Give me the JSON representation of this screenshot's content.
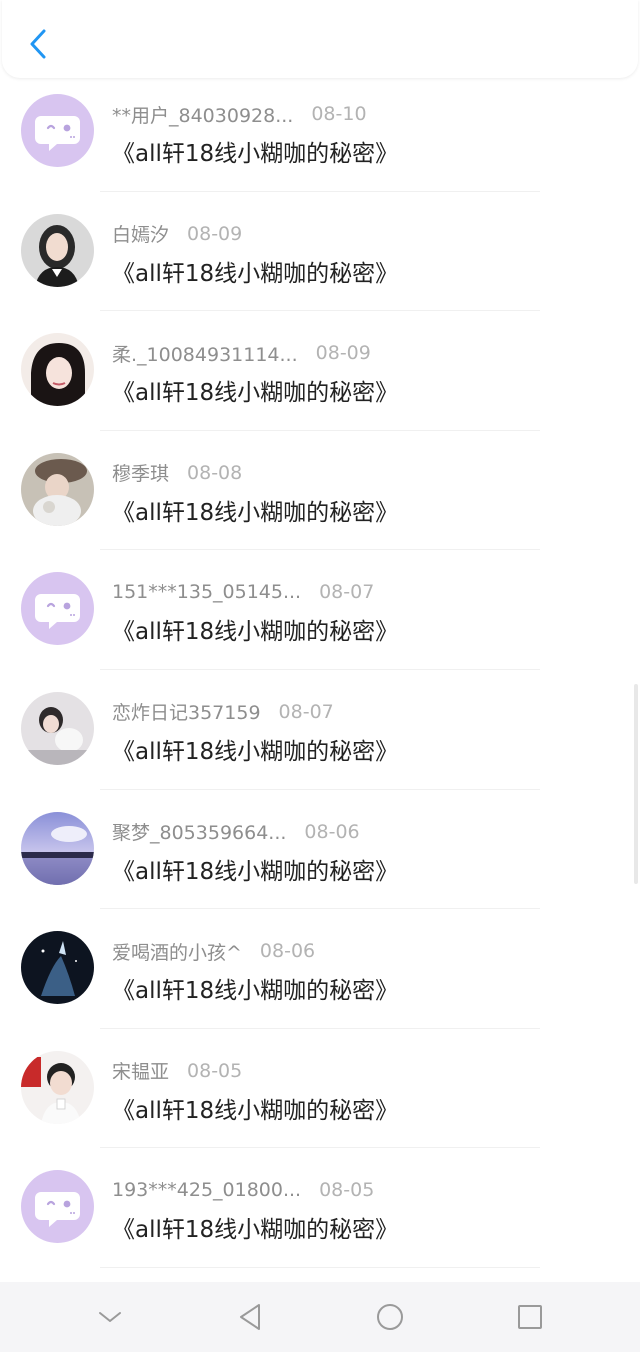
{
  "header": {
    "back_label": "<"
  },
  "comments": [
    {
      "name": "**用户_84030928...",
      "date": "08-10",
      "text": "《all轩18线小糊咖的秘密》",
      "avatar": "default-avatar-icon"
    },
    {
      "name": "白嫣汐",
      "date": "08-09",
      "text": "《all轩18线小糊咖的秘密》",
      "avatar": "user-photo"
    },
    {
      "name": "柔._10084931114...",
      "date": "08-09",
      "text": "《all轩18线小糊咖的秘密》",
      "avatar": "user-photo"
    },
    {
      "name": "穆季琪",
      "date": "08-08",
      "text": "《all轩18线小糊咖的秘密》",
      "avatar": "user-photo"
    },
    {
      "name": "151***135_05145...",
      "date": "08-07",
      "text": "《all轩18线小糊咖的秘密》",
      "avatar": "default-avatar-icon"
    },
    {
      "name": "恋炸日记357159",
      "date": "08-07",
      "text": "《all轩18线小糊咖的秘密》",
      "avatar": "user-photo"
    },
    {
      "name": "聚梦_805359664...",
      "date": "08-06",
      "text": "《all轩18线小糊咖的秘密》",
      "avatar": "user-photo"
    },
    {
      "name": "爱喝酒的小孩^",
      "date": "08-06",
      "text": "《all轩18线小糊咖的秘密》",
      "avatar": "user-photo"
    },
    {
      "name": "宋韫亚",
      "date": "08-05",
      "text": "《all轩18线小糊咖的秘密》",
      "avatar": "user-photo"
    },
    {
      "name": "193***425_01800...",
      "date": "08-05",
      "text": "《all轩18线小糊咖的秘密》",
      "avatar": "default-avatar-icon"
    }
  ],
  "colors": {
    "accent": "#2196f3",
    "default_avatar_bg": "#d8c5f0",
    "text_primary": "#222222",
    "text_secondary": "#9a9a9a"
  },
  "system_nav": {
    "items": [
      "collapse-icon",
      "back-triangle-icon",
      "home-circle-icon",
      "recents-square-icon"
    ]
  }
}
